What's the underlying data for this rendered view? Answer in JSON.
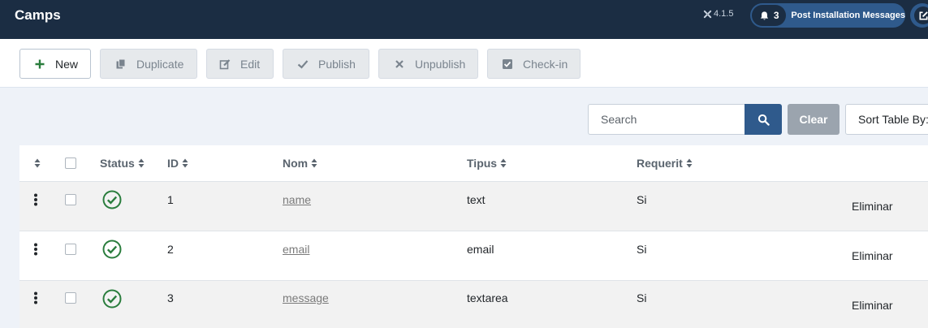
{
  "header": {
    "title": "Camps",
    "version": "4.1.5",
    "messages_count": "3",
    "messages_label": "Post Installation Messages"
  },
  "toolbar": {
    "new_label": "New",
    "duplicate_label": "Duplicate",
    "edit_label": "Edit",
    "publish_label": "Publish",
    "unpublish_label": "Unpublish",
    "checkin_label": "Check-in"
  },
  "filters": {
    "search_placeholder": "Search",
    "clear_label": "Clear",
    "sort_label": "Sort Table By:"
  },
  "table": {
    "columns": {
      "status": "Status",
      "id": "ID",
      "nom": "Nom",
      "tipus": "Tipus",
      "requerit": "Requerit"
    },
    "rows": [
      {
        "id": "1",
        "nom": "name",
        "tipus": "text",
        "requerit": "Si",
        "action": "Eliminar"
      },
      {
        "id": "2",
        "nom": "email",
        "tipus": "email",
        "requerit": "Si",
        "action": "Eliminar"
      },
      {
        "id": "3",
        "nom": "message",
        "tipus": "textarea",
        "requerit": "Si",
        "action": "Eliminar"
      }
    ]
  },
  "colors": {
    "header_bg": "#1b2d43",
    "accent": "#2f5a8c",
    "published_green": "#2a7d3d"
  }
}
